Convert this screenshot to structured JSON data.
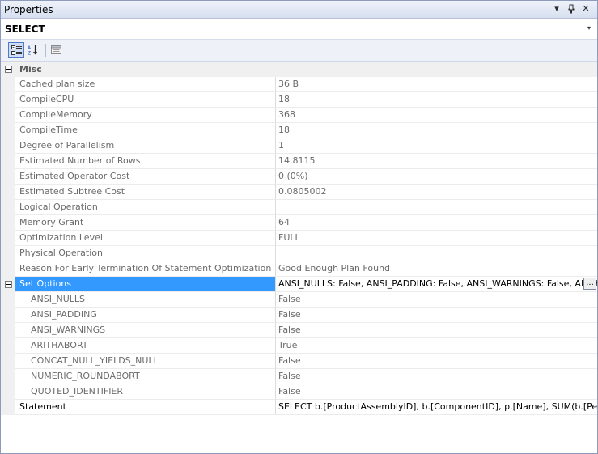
{
  "titlebar": {
    "title": "Properties",
    "dropdown_glyph": "▾",
    "pin_glyph": "ᵩ",
    "close_glyph": "✕"
  },
  "object_selector": {
    "value": "SELECT",
    "dropdown_glyph": "▾"
  },
  "toolbar": {
    "buttons": [
      {
        "name": "categorized-button",
        "icon": "categorized-icon",
        "active": true
      },
      {
        "name": "alphabetical-button",
        "icon": "alphabetical-icon",
        "active": false
      },
      {
        "name": "property-pages-button",
        "icon": "property-pages-icon",
        "active": false
      }
    ]
  },
  "grid": {
    "category": {
      "label": "Misc",
      "expanded": true
    },
    "rows": [
      {
        "name": "Cached plan size",
        "value": "36 B"
      },
      {
        "name": "CompileCPU",
        "value": "18"
      },
      {
        "name": "CompileMemory",
        "value": "368"
      },
      {
        "name": "CompileTime",
        "value": "18"
      },
      {
        "name": "Degree of Parallelism",
        "value": "1"
      },
      {
        "name": "Estimated Number of Rows",
        "value": "14.8115"
      },
      {
        "name": "Estimated Operator Cost",
        "value": "0 (0%)"
      },
      {
        "name": "Estimated Subtree Cost",
        "value": "0.0805002"
      },
      {
        "name": "Logical Operation",
        "value": ""
      },
      {
        "name": "Memory Grant",
        "value": "64"
      },
      {
        "name": "Optimization Level",
        "value": "FULL"
      },
      {
        "name": "Physical Operation",
        "value": ""
      },
      {
        "name": "Reason For Early Termination Of Statement Optimization",
        "value": "Good Enough Plan Found"
      },
      {
        "name": "Set Options",
        "value": "ANSI_NULLS: False, ANSI_PADDING: False, ANSI_WARNINGS: False, ARITHABORT: True, CONCAT_NULL_YIELDS_NULL: False, NUMERIC_ROUNDABORT: False, QUOTED_IDENTIFIER: False",
        "selected": true,
        "expandable": true,
        "ellipsis": "..."
      },
      {
        "name": "ANSI_NULLS",
        "value": "False",
        "child": true
      },
      {
        "name": "ANSI_PADDING",
        "value": "False",
        "child": true
      },
      {
        "name": "ANSI_WARNINGS",
        "value": "False",
        "child": true
      },
      {
        "name": "ARITHABORT",
        "value": "True",
        "child": true
      },
      {
        "name": "CONCAT_NULL_YIELDS_NULL",
        "value": "False",
        "child": true
      },
      {
        "name": "NUMERIC_ROUNDABORT",
        "value": "False",
        "child": true
      },
      {
        "name": "QUOTED_IDENTIFIER",
        "value": "False",
        "child": true
      },
      {
        "name": "Statement",
        "value": "SELECT b.[ProductAssemblyID], b.[ComponentID], p.[Name], SUM(b.[PerAssemblyQty])",
        "dark": true
      }
    ]
  },
  "colors": {
    "selection": "#3399ff",
    "gutter": "#f0f0f0",
    "readonly_text": "#6b6b6b"
  }
}
